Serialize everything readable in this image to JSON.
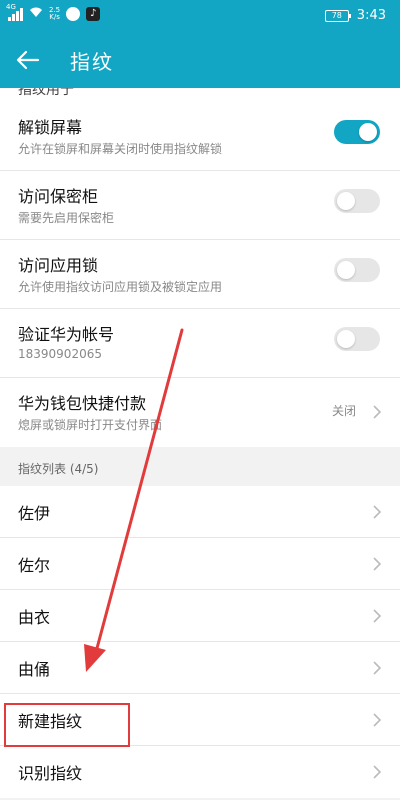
{
  "status_bar": {
    "network": "4G",
    "speed_value": "2.5",
    "speed_unit": "K/s",
    "battery": "78",
    "time": "3:43"
  },
  "app_bar": {
    "title": "指纹"
  },
  "partial_row": {
    "label": "指纹用于"
  },
  "settings": [
    {
      "title": "解锁屏幕",
      "subtitle": "允许在锁屏和屏幕关闭时使用指纹解锁",
      "control": "toggle",
      "on": true
    },
    {
      "title": "访问保密柜",
      "subtitle": "需要先启用保密柜",
      "control": "toggle",
      "on": false
    },
    {
      "title": "访问应用锁",
      "subtitle": "允许使用指纹访问应用锁及被锁定应用",
      "control": "toggle",
      "on": false
    },
    {
      "title": "验证华为帐号",
      "subtitle": "18390902065",
      "control": "toggle",
      "on": false
    },
    {
      "title": "华为钱包快捷付款",
      "subtitle": "熄屏或锁屏时打开支付界面",
      "control": "value",
      "value": "关闭"
    }
  ],
  "section": {
    "label": "指纹列表 (4/5)"
  },
  "fingerprints": [
    {
      "label": "佐伊"
    },
    {
      "label": "佐尔"
    },
    {
      "label": "由衣"
    },
    {
      "label": "由俑"
    },
    {
      "label": "新建指纹"
    },
    {
      "label": "识别指纹"
    }
  ],
  "annotation": {
    "color": "#e23b3b",
    "highlighted_item": "新建指纹"
  }
}
